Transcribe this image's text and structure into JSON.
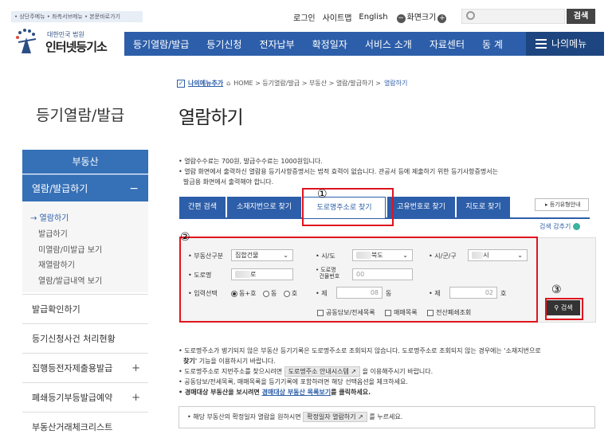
{
  "topbar": {
    "skip_links": "• 상단주메뉴 • 좌측서브메뉴 • 본문바로가기",
    "login": "로그인",
    "sitemap": "사이트맵",
    "english": "English",
    "zoom_label": "화면크기",
    "zoom_minus": "−",
    "zoom_plus": "+",
    "search_button": "검색"
  },
  "logo": {
    "line1": "대한민국 법원",
    "line2": "인터넷등기소"
  },
  "gnb": {
    "items": [
      "등기열람/발급",
      "등기신청",
      "전자납부",
      "확정일자",
      "서비스 소개",
      "자료센터",
      "동 계"
    ],
    "my_menu": "나의메뉴"
  },
  "breadcrumb": {
    "add_my_menu": "나의메뉴추가",
    "path": "HOME > 등기열람/발급 > 부동산 > 열람/발급하기 >",
    "current": "열람하기"
  },
  "sidebar": {
    "title": "등기열람/발급",
    "section": "부동산",
    "active": "열람/발급하기",
    "active_toggle": "−",
    "sub_items": [
      "→ 열람하기",
      "발급하기",
      "미열람/미발급 보기",
      "재열람하기",
      "열람/발급내역 보기"
    ],
    "items": [
      {
        "label": "발급확인하기",
        "toggle": ""
      },
      {
        "label": "등기신청사건 처리현황",
        "toggle": ""
      },
      {
        "label": "집행등전자제출용발급",
        "toggle": "+"
      },
      {
        "label": "폐쇄등기부등발급예약",
        "toggle": "+"
      },
      {
        "label": "부동산거래체크리스트",
        "toggle": ""
      }
    ]
  },
  "main": {
    "title": "열람하기",
    "notes": [
      "• 열람수수료는 700원, 발급수수료는 1000원입니다.",
      "• 열람 화면에서 출력하신 열람용 등기사항증명서는 법적 효력이 없습니다. 관공서 등에 제출하기 위한 등기사항증명서는",
      "  발급용 화면에서 출력해야 합니다."
    ],
    "tabs": [
      "간편 검색",
      "소재지번으로 찾기",
      "도로명주소로 찾기",
      "고유번호로 찾기",
      "지도로 찾기"
    ],
    "guide_button": "▸ 등기유형안내",
    "fold": "검색 감추기"
  },
  "form": {
    "property_type_label": "• 부동산구분",
    "property_type_value": "집합건물",
    "sido_label": "• 시/도",
    "sido_value": "북도",
    "sigungu_label": "• 시/군/구",
    "sigungu_value": "시",
    "road_label": "• 도로명",
    "road_value": "로",
    "road_no_label": "• 도로명\n  건물번호",
    "road_no_value": "00",
    "input_select_label": "• 입력선택",
    "radio_options": [
      "동+호",
      "동",
      "호"
    ],
    "dong_label": "• 제",
    "dong_value": "08",
    "dong_unit": "동",
    "ho_label": "• 제",
    "ho_value": "02",
    "ho_unit": "호",
    "checks": [
      "공동담보/전세목록",
      "매매목록",
      "전산폐쇄조회"
    ],
    "search_button": "검색"
  },
  "annotations": [
    "①",
    "②",
    "③"
  ],
  "notes2": {
    "line1": "• 도로명주소가 병기되지 않은 부동산 등기기록은 도로명주소로 조회되지 않습니다. 도로명주소로 조회되지 않는 경우에는 '소재지번으로",
    "line1_bold": "찾기'",
    "line1_rest": " 기능을 이용하시기 바랍니다.",
    "line2_pre": "• 도로명주소로 지번주소를 찾으시려면",
    "line2_btn": "도로명주소 안내시스템",
    "line2_post": "을 이용해주시기 바랍니다.",
    "line3": "• 공동담보/전세목록, 매매목록을 등기기록에 포함하려면 해당 선택옵션을 체크하세요.",
    "line4_pre": "• 경매대상 부동산을 보시려면",
    "line4_link": "경매대상 부동산 목록보기",
    "line4_post": "를 클릭하세요.",
    "info_pre": "• 해당 부동산의 확정일자 열람을 원하시면",
    "info_btn": "확정일자 열람하기",
    "info_post": "를 누르세요."
  }
}
